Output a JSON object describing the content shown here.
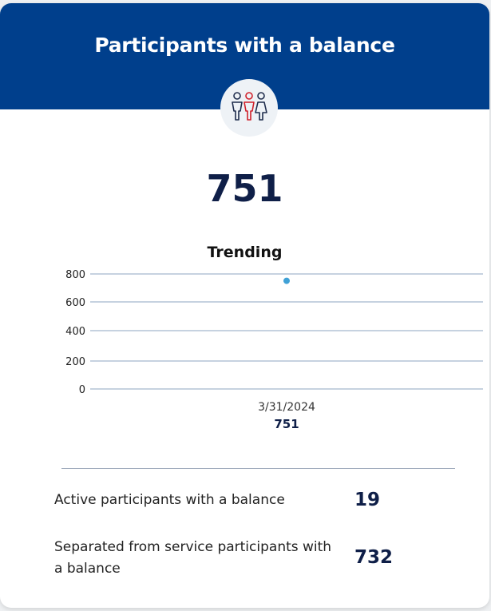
{
  "card": {
    "title": "Participants with a balance",
    "icon": "people-group-icon",
    "total": "751"
  },
  "trending": {
    "title": "Trending"
  },
  "chart_data": {
    "type": "scatter",
    "title": "Trending",
    "y_ticks": [
      "800",
      "600",
      "400",
      "200",
      "0"
    ],
    "ylim": [
      0,
      800
    ],
    "grid": true,
    "points": [
      {
        "x": "3/31/2024",
        "y": 751,
        "label": "751"
      }
    ]
  },
  "stats": [
    {
      "label": "Active participants with a balance",
      "value": "19"
    },
    {
      "label": "Separated from service participants with a balance",
      "value": "732"
    }
  ],
  "colors": {
    "header": "#003f8c",
    "accent_red": "#d0202a",
    "point": "#3fa1d6",
    "number": "#0f1f48",
    "gridline": "#8ea4c2"
  }
}
